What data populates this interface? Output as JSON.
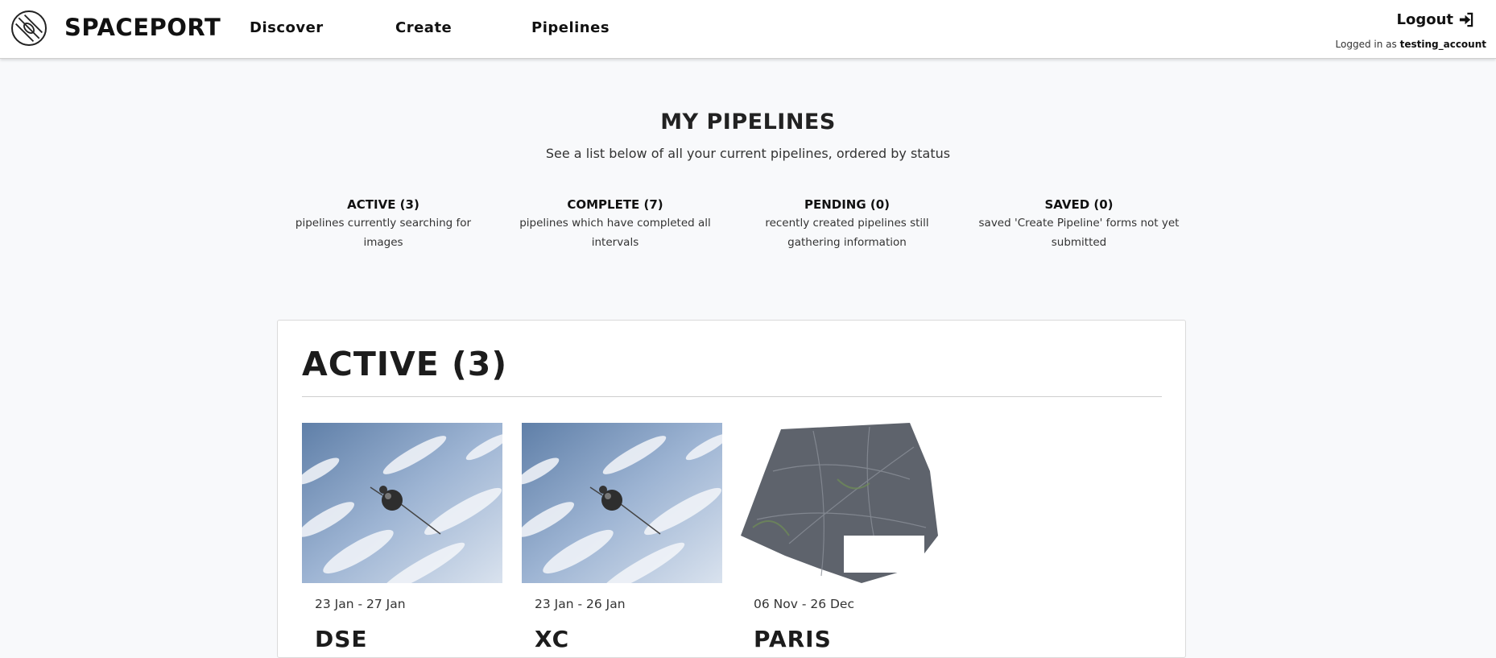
{
  "header": {
    "brand": "SPACEPORT",
    "nav": [
      "Discover",
      "Create",
      "Pipelines"
    ],
    "logout_label": "Logout",
    "logged_in_prefix": "Logged in as",
    "username": "testing_account"
  },
  "main": {
    "title": "MY PIPELINES",
    "subtitle": "See a list below of all your current pipelines, ordered by status",
    "statuses": [
      {
        "title": "ACTIVE (3)",
        "description": "pipelines currently searching for images"
      },
      {
        "title": "COMPLETE (7)",
        "description": "pipelines which have completed all intervals"
      },
      {
        "title": "PENDING (0)",
        "description": "recently created pipelines still gathering information"
      },
      {
        "title": "SAVED (0)",
        "description": "saved 'Create Pipeline' forms not yet submitted"
      }
    ]
  },
  "active_section": {
    "title": "ACTIVE (3)",
    "pipelines": [
      {
        "dates": "23 Jan - 27 Jan",
        "name": "DSE",
        "image": "satellite-over-earth"
      },
      {
        "dates": "23 Jan - 26 Jan",
        "name": "XC",
        "image": "satellite-over-earth"
      },
      {
        "dates": "06 Nov - 26 Dec",
        "name": "PARIS",
        "image": "satellite-map-paris"
      }
    ]
  }
}
